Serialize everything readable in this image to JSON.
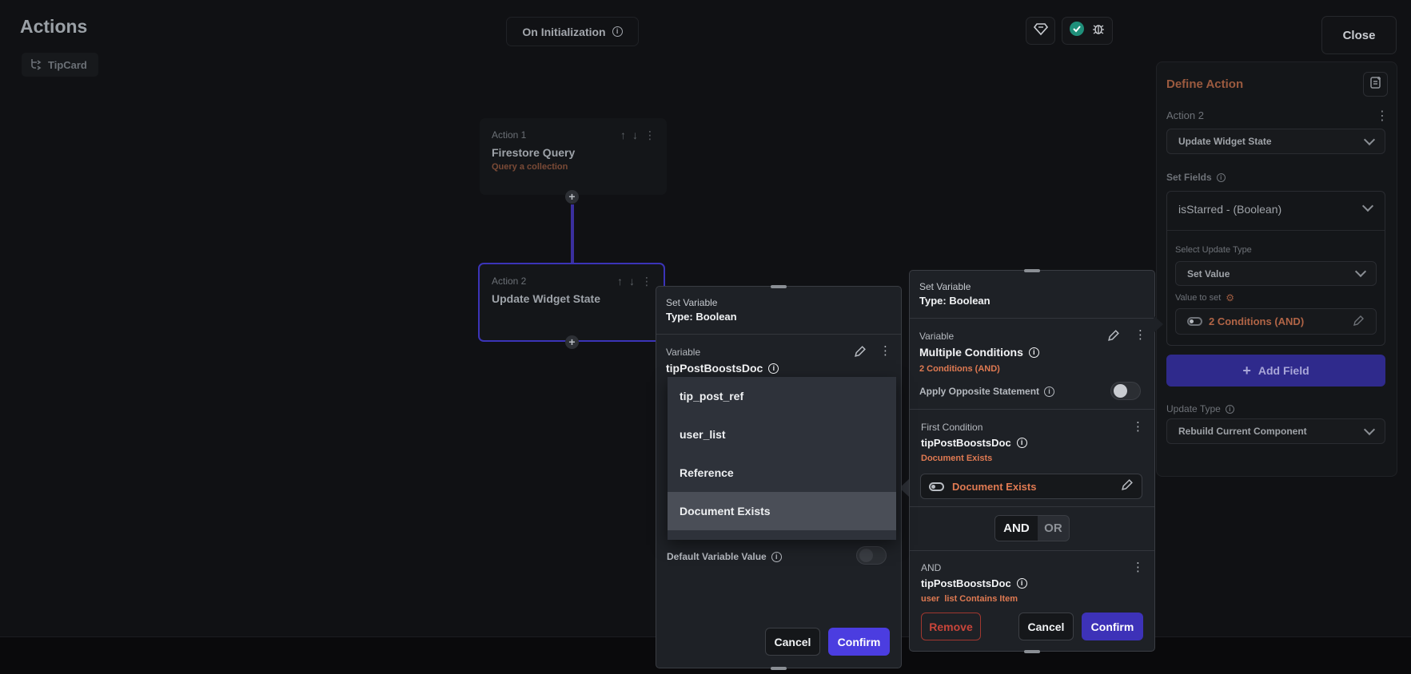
{
  "header": {
    "title": "Actions",
    "widget_chip": "TipCard",
    "trigger": "On Initialization",
    "close": "Close"
  },
  "nodes": [
    {
      "label": "Action 1",
      "name": "Firestore Query",
      "sub": "Query a collection"
    },
    {
      "label": "Action 2",
      "name": "Update Widget State",
      "sub": ""
    }
  ],
  "define_action": {
    "header": "Define Action",
    "action_label": "Action 2",
    "action_type": "Update Widget State",
    "set_fields_label": "Set Fields",
    "field": "isStarred - (Boolean)",
    "select_update_type_label": "Select Update Type",
    "update_type_value": "Set Value",
    "value_to_set_label": "Value to set",
    "value_to_set": "2 Conditions (AND)",
    "add_field": "Add Field",
    "update_type_label": "Update Type",
    "update_type": "Rebuild Current Component"
  },
  "left_panel": {
    "title": "Set Variable",
    "type": "Type: Boolean",
    "variable_label": "Variable",
    "variable_name": "tipPostBoostsDoc",
    "dropdown_options": [
      "tip_post_ref",
      "user_list",
      "Reference",
      "Document Exists"
    ],
    "selected_option": "Document Exists",
    "default_label": "Default Variable Value",
    "cancel": "Cancel",
    "confirm": "Confirm"
  },
  "right_panel": {
    "title": "Set Variable",
    "type": "Type: Boolean",
    "variable_label": "Variable",
    "variable_name": "Multiple Conditions",
    "variable_sub": "2 Conditions (AND)",
    "apply_opposite": "Apply Opposite Statement",
    "first_condition_label": "First Condition",
    "first_condition_name": "tipPostBoostsDoc",
    "first_condition_sub": "Document Exists",
    "first_condition_value": "Document Exists",
    "and": "AND",
    "or": "OR",
    "second_label": "AND",
    "second_name": "tipPostBoostsDoc",
    "second_sub": "user_list Contains Item",
    "remove": "Remove",
    "cancel": "Cancel",
    "confirm": "Confirm"
  },
  "colors": {
    "accent": "#4b3de0",
    "orange": "#e07a52",
    "define_header": "#9b5a3f",
    "connector": "#3a2f9e",
    "success": "#1f8f7a"
  }
}
